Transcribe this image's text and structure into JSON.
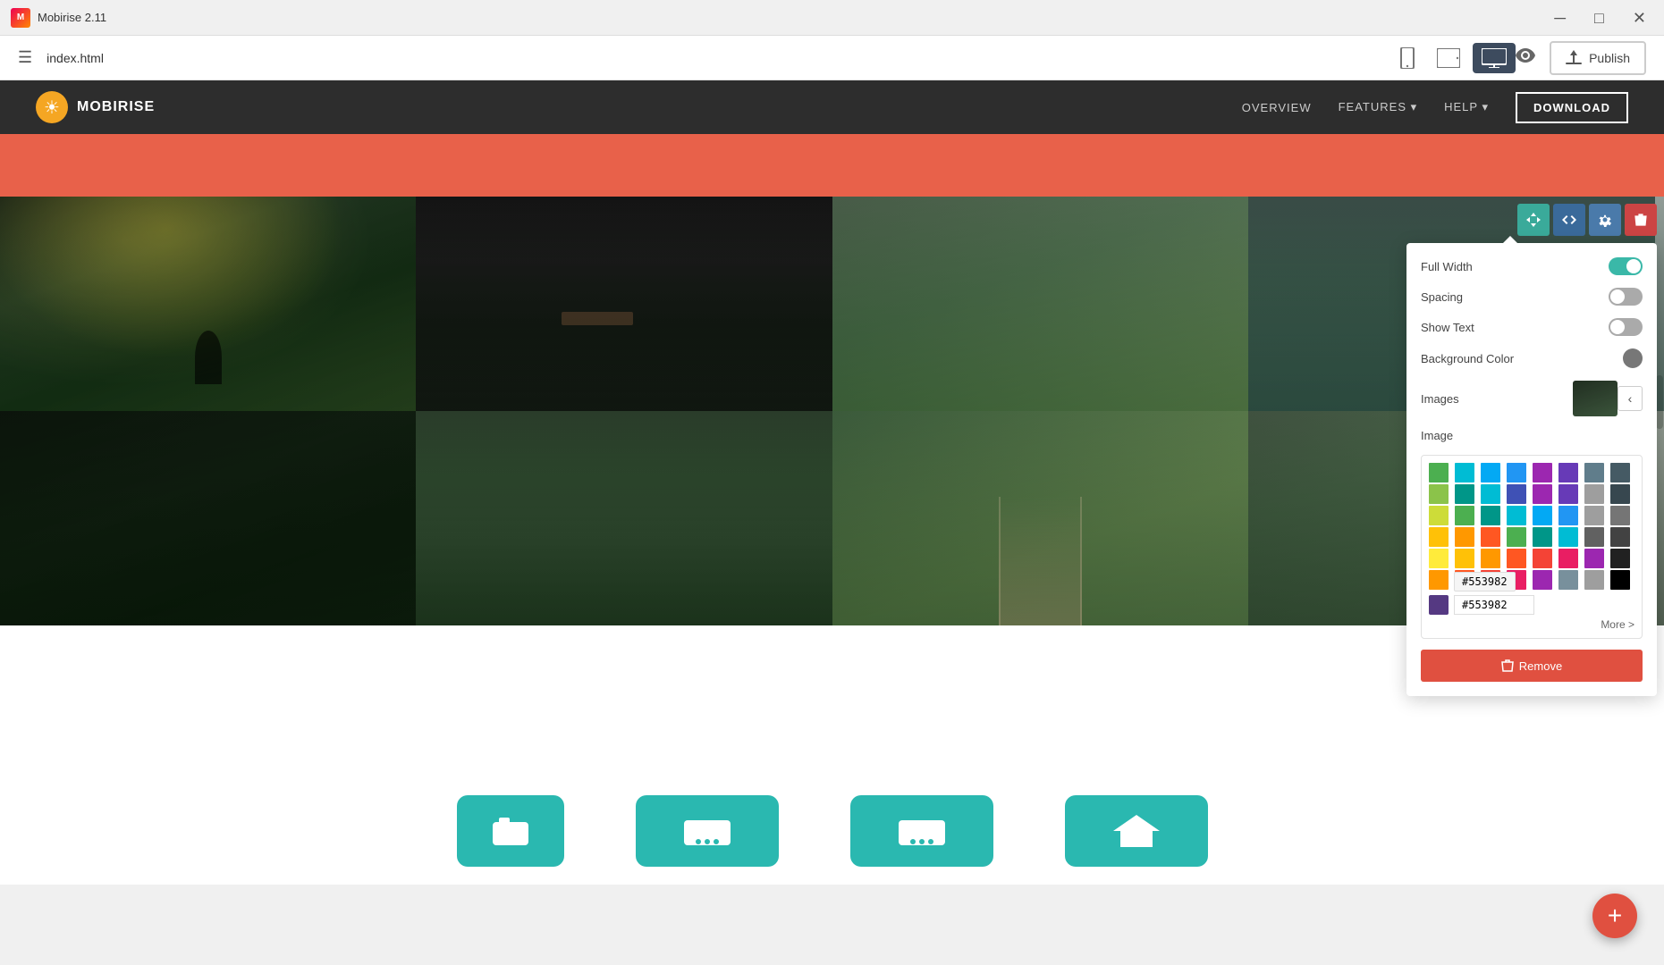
{
  "titleBar": {
    "appName": "Mobirise 2.11",
    "minimize": "─",
    "maximize": "□",
    "close": "✕"
  },
  "toolbar": {
    "hamburger": "☰",
    "filename": "index.html",
    "deviceMobile": "📱",
    "deviceTablet": "⬜",
    "deviceDesktop": "🖥",
    "eyeIcon": "👁",
    "publishLabel": "Publish",
    "uploadIcon": "⬆"
  },
  "siteNavbar": {
    "brandIcon": "☀",
    "brandName": "MOBIRISE",
    "links": [
      "OVERVIEW",
      "FEATURES ▾",
      "HELP ▾"
    ],
    "downloadBtn": "DOWNLOAD"
  },
  "settingsPanel": {
    "fullWidthLabel": "Full Width",
    "spacingLabel": "Spacing",
    "showTextLabel": "Show Text",
    "backgroundColorLabel": "Background Color",
    "imagesLabel": "Images",
    "imageLabel": "Image",
    "moreLabel": "More >",
    "removeLabel": "Remove"
  },
  "colorPicker": {
    "hexValue": "#553982",
    "colors": [
      [
        "#4CAF50",
        "#00BCD4",
        "#03A9F4",
        "#2196F3",
        "#9C27B0",
        "#673AB7",
        "#3F51B5",
        "#607D8B"
      ],
      [
        "#8BC34A",
        "#009688",
        "#00BCD4",
        "#03A9F4",
        "#2196F3",
        "#9C27B0",
        "#673AB7",
        "#455A64"
      ],
      [
        "#CDDC39",
        "#4CAF50",
        "#009688",
        "#00BCD4",
        "#03A9F4",
        "#2196F3",
        "#9C27B0",
        "#9E9E9E"
      ],
      [
        "#FFC107",
        "#FF9800",
        "#FF5722",
        "#4CAF50",
        "#009688",
        "#00BCD4",
        "#03A9F4",
        "#616161"
      ],
      [
        "#FFEB3B",
        "#FFC107",
        "#FF9800",
        "#FF5722",
        "#F44336",
        "#E91E63",
        "#9C27B0",
        "#212121"
      ],
      [
        "#FF9800",
        "#FF5722",
        "#F44336",
        "#E91E63",
        "#9C27B0",
        "#607D8B",
        "#9E9E9E",
        "#000000"
      ]
    ]
  },
  "fab": {
    "label": "+"
  }
}
